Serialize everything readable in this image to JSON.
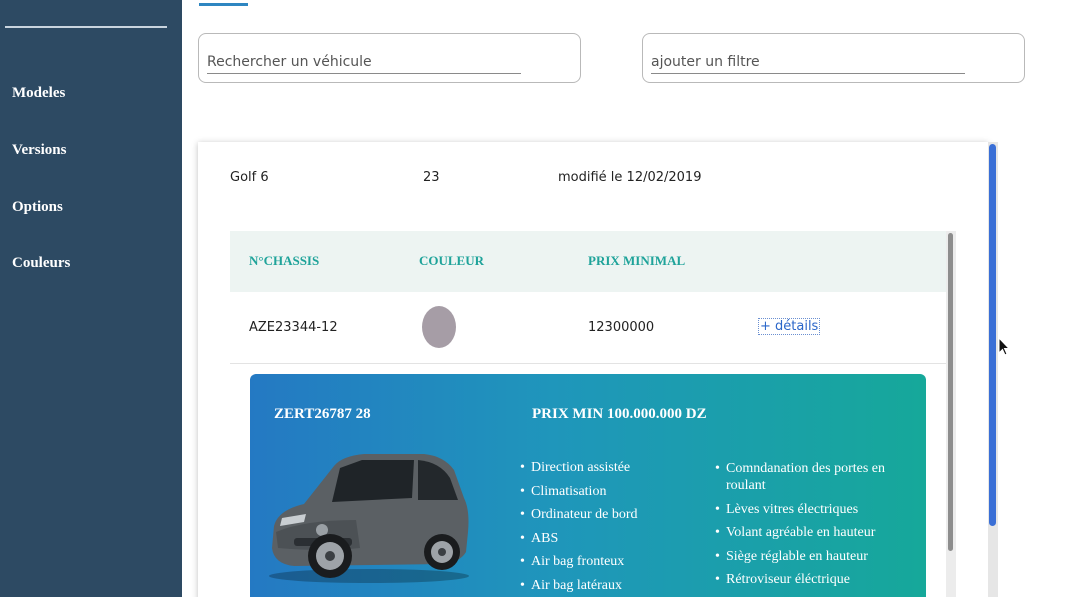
{
  "sidebar": {
    "items": [
      {
        "label": "Modeles"
      },
      {
        "label": "Versions"
      },
      {
        "label": "Options"
      },
      {
        "label": "Couleurs"
      }
    ]
  },
  "search": {
    "vehicle_placeholder": "Rechercher un véhicule",
    "filter_placeholder": "ajouter un filtre"
  },
  "card": {
    "model": "Golf 6",
    "count": "23",
    "modified": "modifié le 12/02/2019"
  },
  "table": {
    "headers": [
      "N°CHASSIS",
      "COULEUR",
      "PRIX MINIMAL"
    ],
    "rows": [
      {
        "chassis": "AZE23344-12",
        "color_hex": "#a69da6",
        "price": "12300000",
        "details": "+ détails"
      }
    ]
  },
  "detail_panel": {
    "code": "ZERT26787 28",
    "price": "PRIX MIN 100.000.000 DZ",
    "image": "car-image",
    "features_left": [
      "Direction assistée",
      "Climatisation",
      "Ordinateur de bord",
      "ABS",
      "Air bag fronteux",
      "Air bag latéraux"
    ],
    "features_right": [
      "Comndanation des portes en roulant",
      "Lèves vitres électriques",
      "Volant agréable en hauteur",
      "Siège réglable en hauteur",
      "Rétroviseur éléctrique"
    ]
  },
  "colors": {
    "sidebar": "#2d4a63",
    "accent": "#2e86c1",
    "teal": "#1fa39a"
  }
}
